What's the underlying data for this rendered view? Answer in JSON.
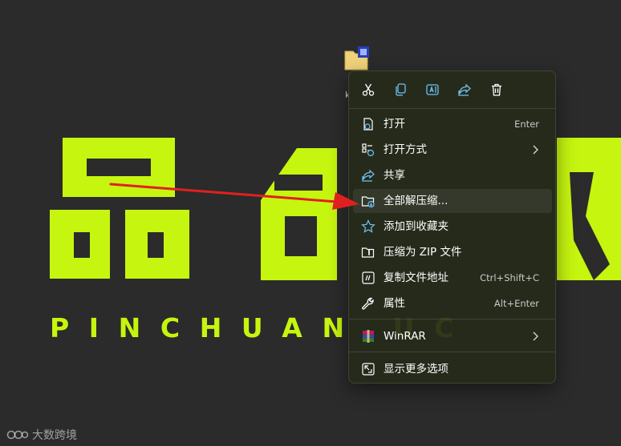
{
  "desktop": {
    "brand_text": "PINCHUAN   UC",
    "file_label_fragment": "k"
  },
  "watermark": {
    "text": "大数跨境"
  },
  "context_menu": {
    "toolbar": [
      {
        "name": "cut-icon"
      },
      {
        "name": "copy-icon"
      },
      {
        "name": "rename-icon"
      },
      {
        "name": "share-icon"
      },
      {
        "name": "delete-icon"
      }
    ],
    "items": [
      {
        "label": "打开",
        "accelerator": "Enter",
        "icon": "open-icon"
      },
      {
        "label": "打开方式",
        "accelerator": "",
        "icon": "open-with-icon",
        "submenu": true
      },
      {
        "label": "共享",
        "accelerator": "",
        "icon": "share-icon"
      },
      {
        "label": "全部解压缩...",
        "accelerator": "",
        "icon": "extract-all-icon",
        "highlighted": true
      },
      {
        "label": "添加到收藏夹",
        "accelerator": "",
        "icon": "star-icon"
      },
      {
        "label": "压缩为 ZIP 文件",
        "accelerator": "",
        "icon": "zip-folder-icon"
      },
      {
        "label": "复制文件地址",
        "accelerator": "Ctrl+Shift+C",
        "icon": "copy-path-icon"
      },
      {
        "label": "属性",
        "accelerator": "Alt+Enter",
        "icon": "properties-icon"
      },
      {
        "label": "WinRAR",
        "accelerator": "",
        "icon": "winrar-icon",
        "submenu": true
      },
      {
        "label": "显示更多选项",
        "accelerator": "",
        "icon": "show-more-options-icon"
      }
    ]
  },
  "colors": {
    "wallpaper_bg": "#2b2b2b",
    "brand_green": "#c6f50f",
    "arrow_red": "#e02020",
    "menu_bg": "#262a1a",
    "icon_blue": "#6cc3f5"
  }
}
